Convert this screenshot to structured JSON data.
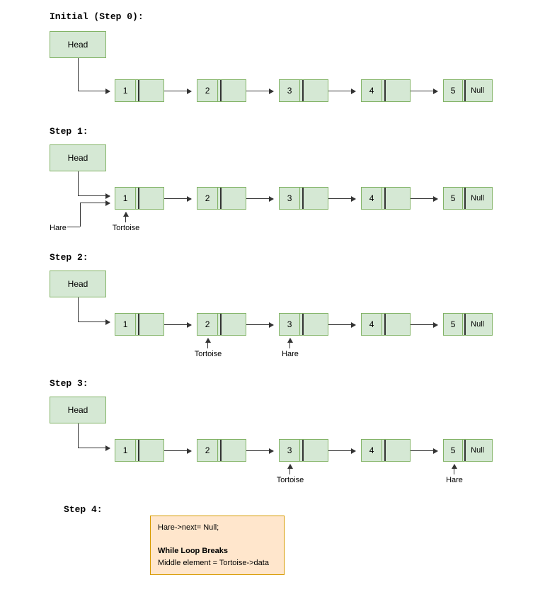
{
  "steps": {
    "s0": {
      "title": "Initial (Step 0):"
    },
    "s1": {
      "title": "Step 1:",
      "tortoise": "Tortoise",
      "hare": "Hare"
    },
    "s2": {
      "title": "Step 2:",
      "tortoise": "Tortoise",
      "hare": "Hare"
    },
    "s3": {
      "title": "Step 3:",
      "tortoise": "Tortoise",
      "hare": "Hare"
    },
    "s4": {
      "title": "Step 4:"
    }
  },
  "head_label": "Head",
  "null_label": "Null",
  "nodes": [
    "1",
    "2",
    "3",
    "4",
    "5"
  ],
  "info": {
    "line1": "Hare->next= Null;",
    "line2": "While Loop Breaks",
    "line3": "Middle element = Tortoise->data"
  },
  "colors": {
    "node_fill": "#d5e8d4",
    "node_stroke": "#82b366",
    "info_fill": "#ffe6cc",
    "info_stroke": "#d79b00"
  }
}
